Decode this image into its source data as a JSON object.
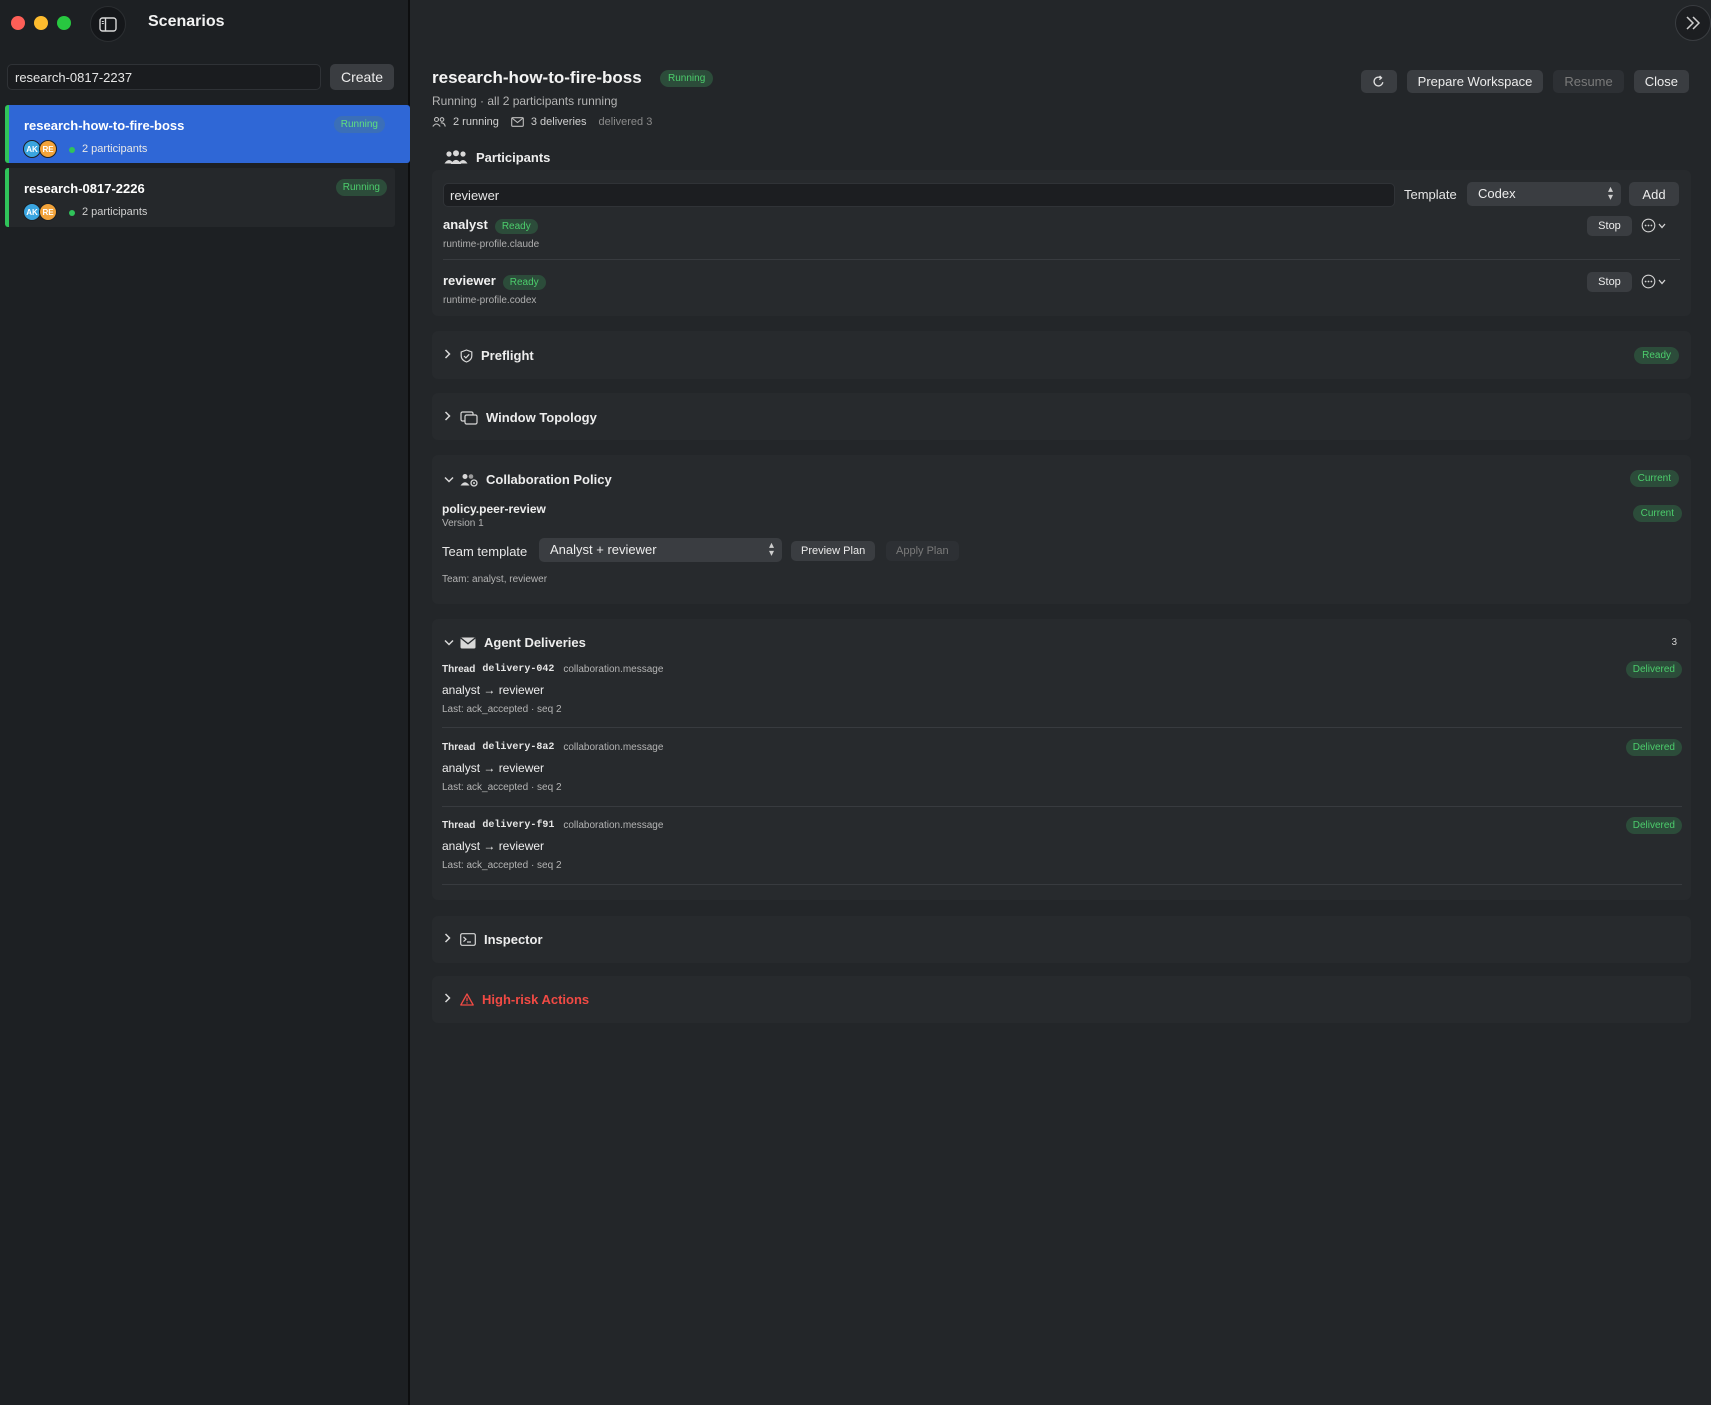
{
  "sidebar": {
    "title": "Scenarios",
    "search_value": "research-0817-2237",
    "create_label": "Create",
    "scenarios": [
      {
        "name": "research-how-to-fire-boss",
        "status": "Running",
        "avatars": [
          "AK",
          "RE"
        ],
        "participants": "2 participants"
      },
      {
        "name": "research-0817-2226",
        "status": "Running",
        "avatars": [
          "AK",
          "RE"
        ],
        "participants": "2 participants"
      }
    ]
  },
  "header": {
    "title": "research-how-to-fire-boss",
    "status": "Running",
    "subtitle": "Running · all 2 participants running",
    "stats": {
      "running": "2 running",
      "deliveries": "3 deliveries",
      "delivered": "delivered 3"
    },
    "actions": {
      "prepare": "Prepare Workspace",
      "resume": "Resume",
      "close": "Close"
    }
  },
  "participants": {
    "title": "Participants",
    "input_value": "reviewer",
    "template_label": "Template",
    "template_value": "Codex",
    "add_label": "Add",
    "items": [
      {
        "name": "analyst",
        "status": "Ready",
        "profile": "runtime-profile.claude",
        "stop": "Stop"
      },
      {
        "name": "reviewer",
        "status": "Ready",
        "profile": "runtime-profile.codex",
        "stop": "Stop"
      }
    ]
  },
  "preflight": {
    "title": "Preflight",
    "status": "Ready"
  },
  "topology": {
    "title": "Window Topology"
  },
  "policy": {
    "title": "Collaboration Policy",
    "status": "Current",
    "name": "policy.peer-review",
    "version": "Version 1",
    "item_status": "Current",
    "team_label": "Team template",
    "team_value": "Analyst + reviewer",
    "preview_label": "Preview Plan",
    "apply_label": "Apply Plan",
    "team_desc": "Team: analyst, reviewer"
  },
  "deliveries": {
    "title": "Agent Deliveries",
    "count": "3",
    "items": [
      {
        "thread_label": "Thread",
        "id": "delivery-042",
        "kind": "collaboration.message",
        "route": "analyst → reviewer",
        "last": "Last: ack_accepted · seq 2",
        "status": "Delivered"
      },
      {
        "thread_label": "Thread",
        "id": "delivery-8a2",
        "kind": "collaboration.message",
        "route": "analyst → reviewer",
        "last": "Last: ack_accepted · seq 2",
        "status": "Delivered"
      },
      {
        "thread_label": "Thread",
        "id": "delivery-f91",
        "kind": "collaboration.message",
        "route": "analyst → reviewer",
        "last": "Last: ack_accepted · seq 2",
        "status": "Delivered"
      }
    ]
  },
  "inspector": {
    "title": "Inspector"
  },
  "high_risk": {
    "title": "High-risk Actions"
  },
  "colors": {
    "accent": "#2f67d6",
    "success": "#30c35a",
    "danger": "#f14a44",
    "background": "#232629"
  },
  "icons": {
    "sidebar_toggle": "sidebar-icon",
    "expand": "double-chevron-right-icon",
    "refresh": "refresh-icon",
    "participants": "people-icon",
    "preflight": "shield-check-icon",
    "topology": "windows-icon",
    "policy": "people-gear-icon",
    "deliveries": "envelope-icon",
    "inspector": "terminal-icon",
    "high_risk": "warning-icon"
  }
}
